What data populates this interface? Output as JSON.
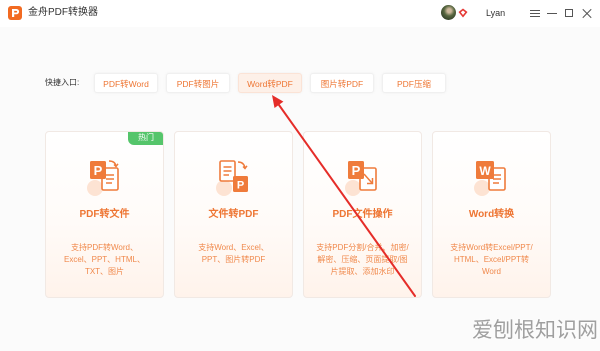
{
  "app": {
    "title": "金舟PDF转换器",
    "logo_icon": "app-logo-icon"
  },
  "user": {
    "name": "Lyan",
    "avatar_icon": "user-avatar",
    "vip_icon": "vip-badge-icon"
  },
  "window_controls": {
    "menu_icon": "menu-icon",
    "minimize_icon": "minimize-icon",
    "maximize_icon": "maximize-icon",
    "close_icon": "close-icon"
  },
  "quick_entry": {
    "label": "快捷入口:",
    "items": [
      {
        "label": "PDF转Word"
      },
      {
        "label": "PDF转图片"
      },
      {
        "label": "Word转PDF",
        "hovered": true
      },
      {
        "label": "图片转PDF"
      },
      {
        "label": "PDF压缩"
      }
    ]
  },
  "cards": [
    {
      "title": "PDF转文件",
      "badge": "热门",
      "icon": "pdf-to-file-icon",
      "icon_letter": "P",
      "description": [
        "支持PDF转Word、",
        "Excel、PPT、HTML、",
        "TXT、图片"
      ]
    },
    {
      "title": "文件转PDF",
      "icon": "file-to-pdf-icon",
      "icon_letter": "P",
      "description": [
        "支持Word、Excel、",
        "PPT、图片转PDF"
      ]
    },
    {
      "title": "PDF文件操作",
      "icon": "pdf-operations-icon",
      "icon_letter": "P",
      "description": [
        "支持PDF分割/合并、加密/",
        "解密、压缩、页面提取/图",
        "片提取、添加水印"
      ]
    },
    {
      "title": "Word转换",
      "icon": "word-convert-icon",
      "icon_letter": "W",
      "description": [
        "支持Word转Excel/PPT/",
        "HTML、Excel/PPT转",
        "Word"
      ]
    }
  ],
  "annotation_icon": "red-arrow-annotation",
  "watermark": "爱刨根知识网",
  "colors": {
    "accent": "#ee7634",
    "badge": "#55c56b",
    "annotation_red": "#e52d29",
    "text_dark": "#333333"
  }
}
